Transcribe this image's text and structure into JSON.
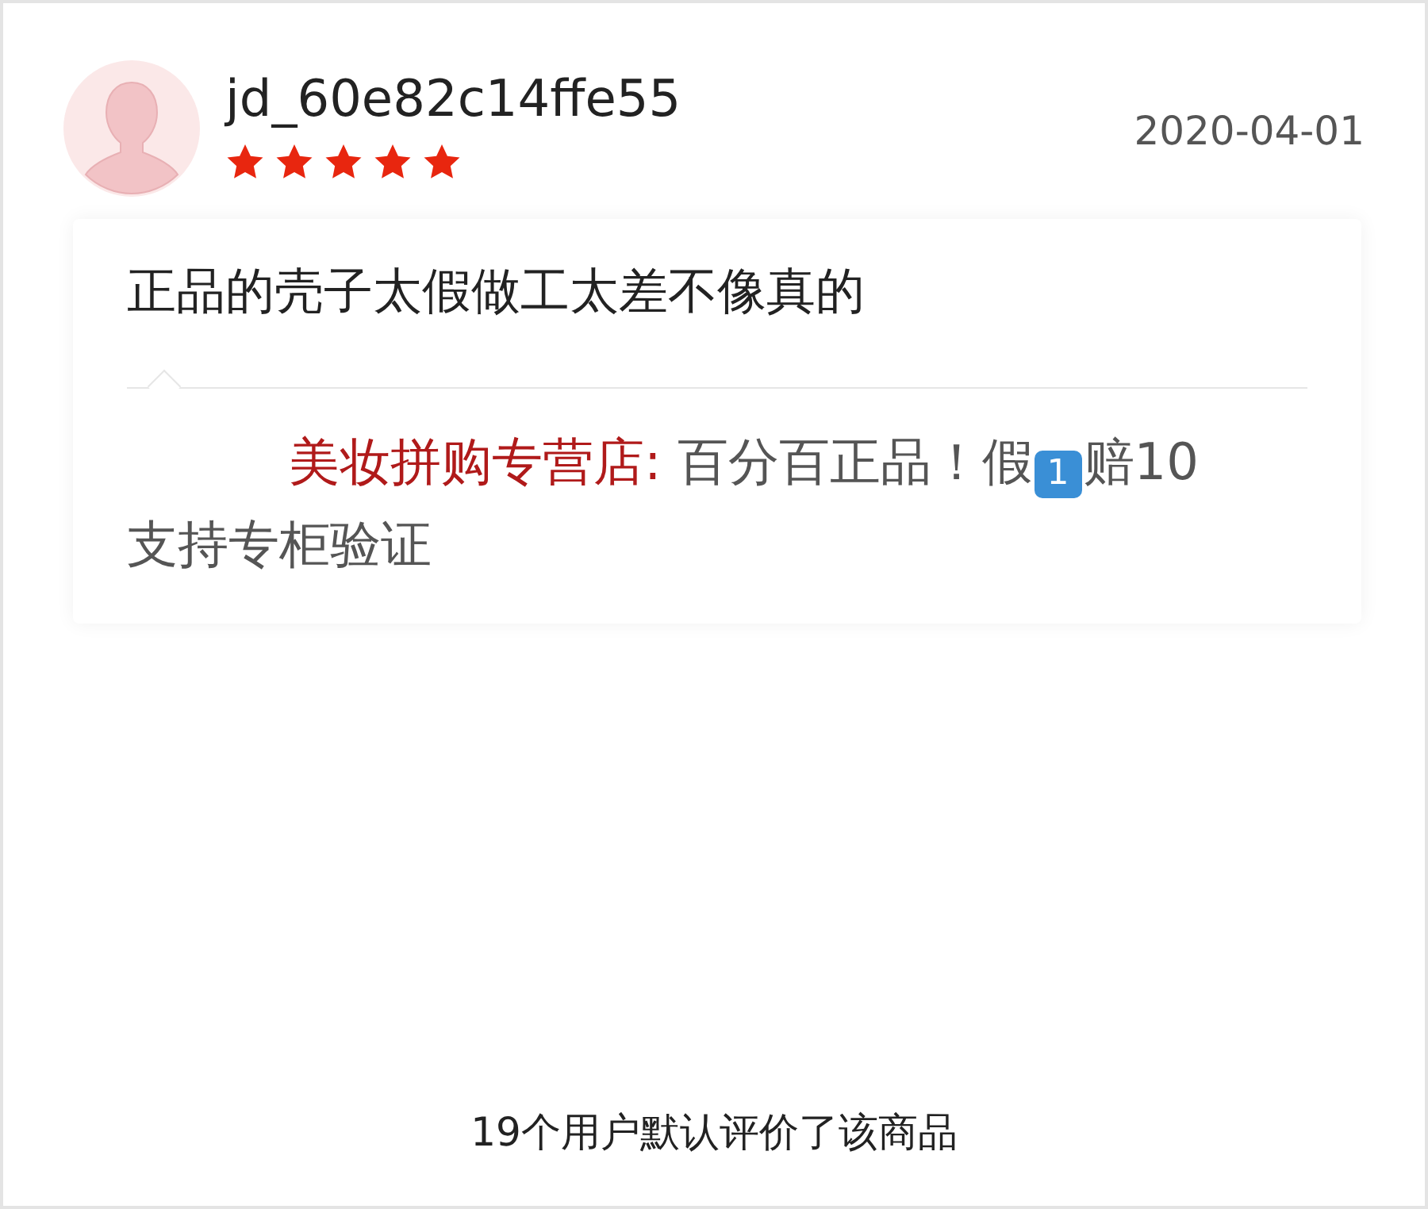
{
  "review": {
    "username": "jd_60e82c14ffe55",
    "stars": 5,
    "date": "2020-04-01",
    "text": "正品的壳子太假做工太差不像真的"
  },
  "reply": {
    "author": "美妆拼购专营店:",
    "parts": [
      {
        "kind": "text",
        "text": "百分百正品！假"
      },
      {
        "kind": "keycap",
        "text": "1"
      },
      {
        "kind": "text",
        "text": "赔10支持专柜验证"
      }
    ]
  },
  "footer": "19个用户默认评价了该商品"
}
